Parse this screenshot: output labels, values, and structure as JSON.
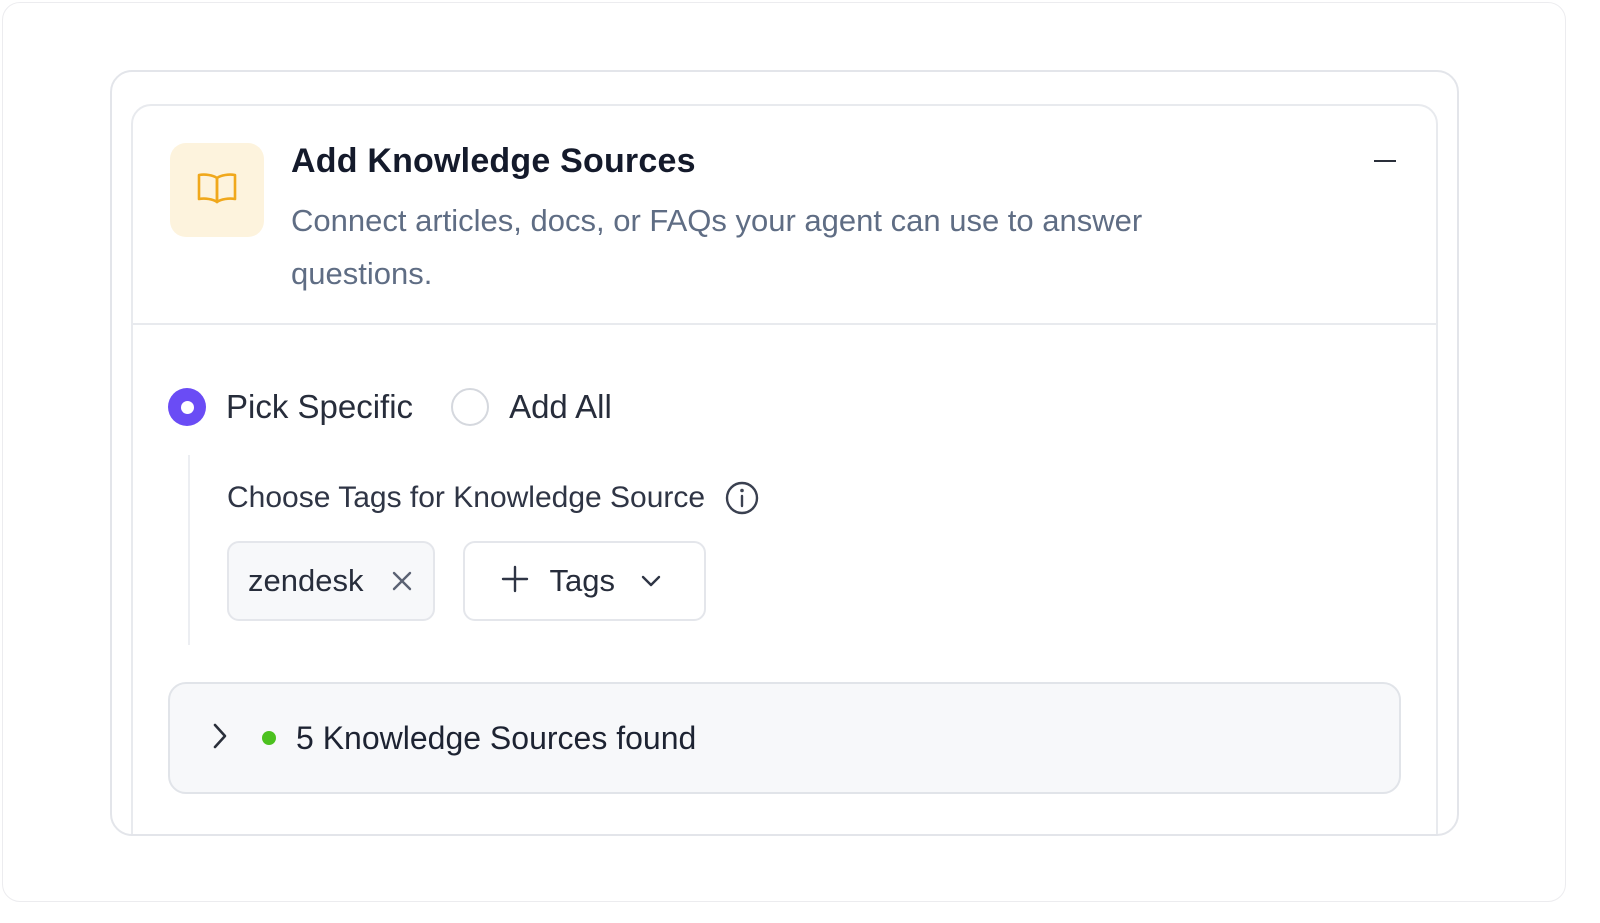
{
  "panel": {
    "title": "Add Knowledge Sources",
    "subtitle": "Connect articles, docs, or FAQs your agent can use to answer questions.",
    "icon": "book-open-icon",
    "collapse_icon": "minus-icon"
  },
  "selection_mode": {
    "options": [
      {
        "label": "Pick Specific",
        "selected": true
      },
      {
        "label": "Add All",
        "selected": false
      }
    ]
  },
  "tags": {
    "label": "Choose Tags for Knowledge Source",
    "info_icon": "info-icon",
    "selected": [
      {
        "label": "zendesk"
      }
    ],
    "add_button_label": "Tags"
  },
  "results": {
    "text": "5 Knowledge Sources found",
    "status_color": "#4cc11f"
  },
  "colors": {
    "accent": "#6a4cf5",
    "icon_tile_bg": "#fdf3dd",
    "icon_stroke": "#f0a81c",
    "status_ok": "#4cc11f"
  }
}
